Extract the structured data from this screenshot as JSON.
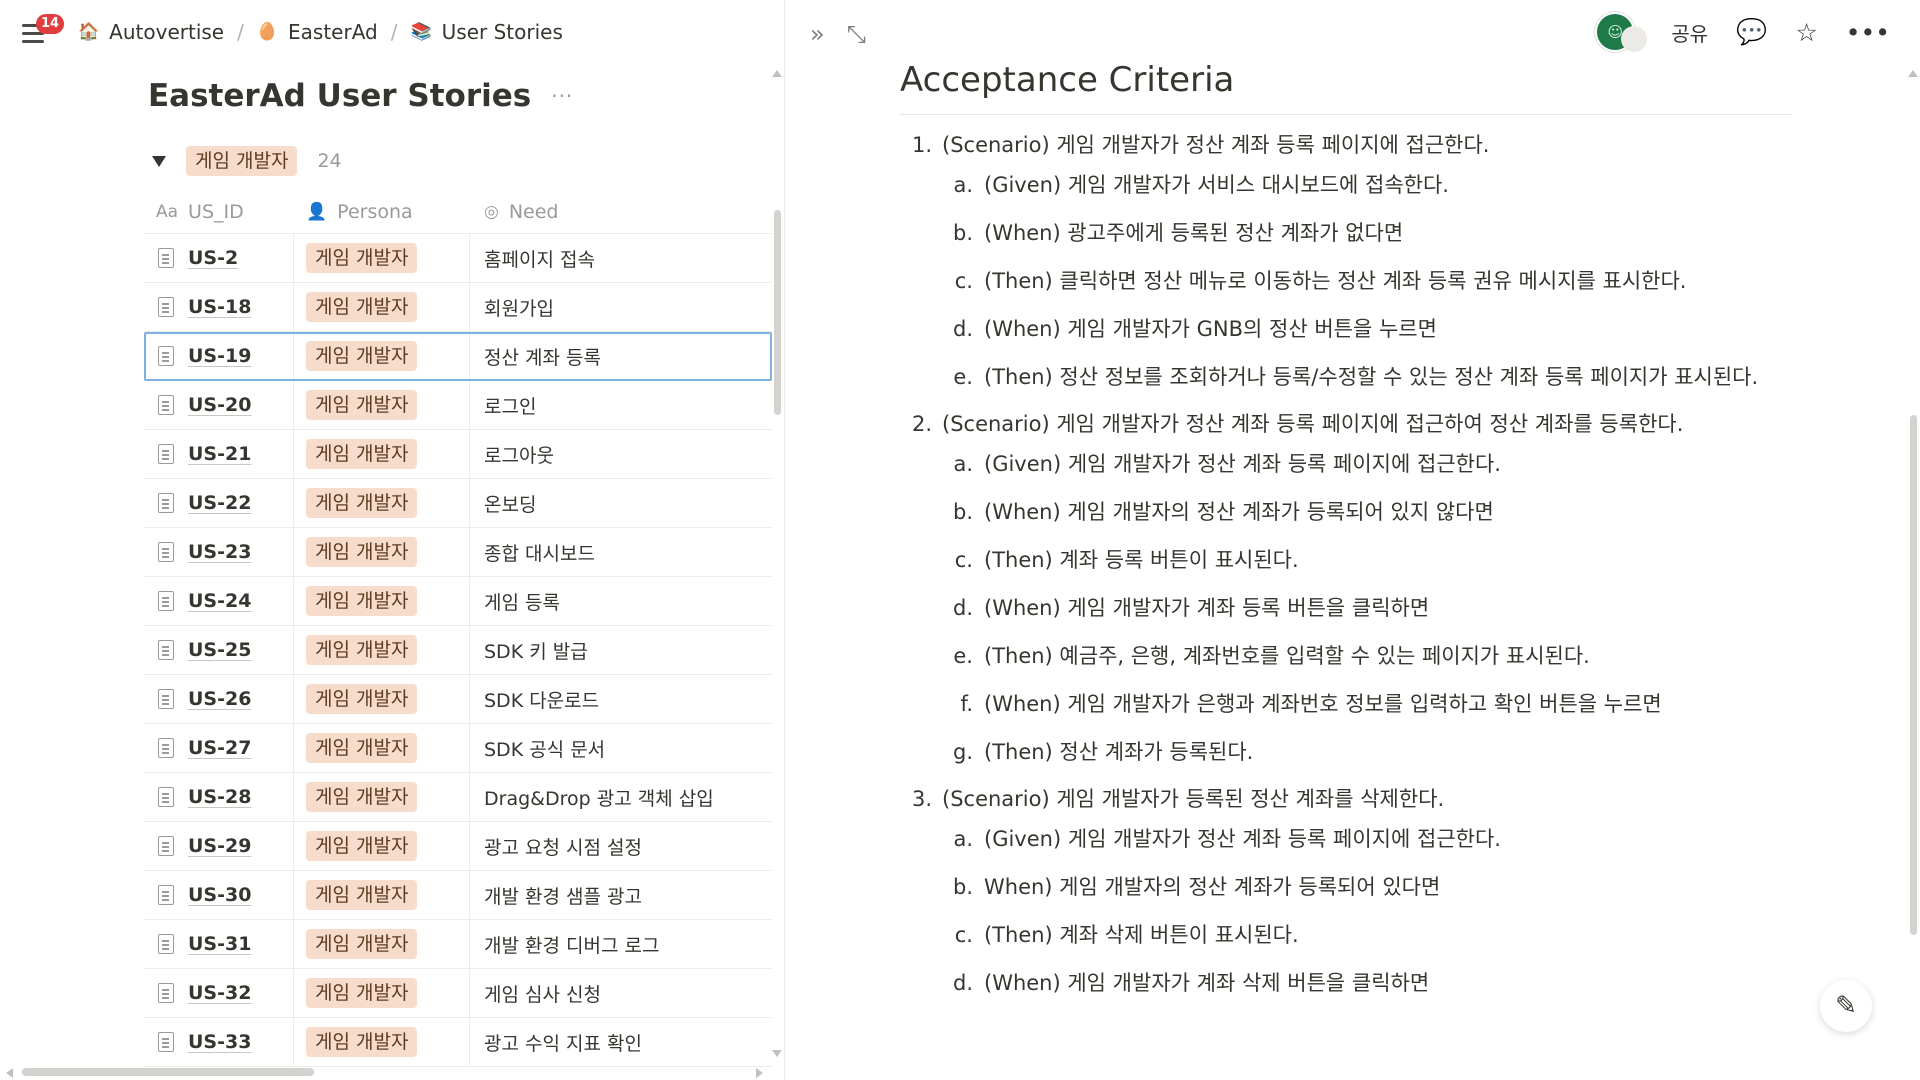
{
  "notification_count": "14",
  "breadcrumb": [
    {
      "icon": "house-icon",
      "label": "Autovertise"
    },
    {
      "icon": "egg-icon",
      "label": "EasterAd"
    },
    {
      "icon": "books-icon",
      "label": "User Stories"
    }
  ],
  "database": {
    "title": "EasterAd User Stories",
    "more_label": "···",
    "group": {
      "label": "게임 개발자",
      "count": "24"
    },
    "columns": {
      "id": "US_ID",
      "id_prefix": "Aa",
      "persona": "Persona",
      "need": "Need"
    },
    "rows": [
      {
        "id": "US-2",
        "persona": "게임 개발자",
        "need": "홈페이지 접속"
      },
      {
        "id": "US-18",
        "persona": "게임 개발자",
        "need": "회원가입"
      },
      {
        "id": "US-19",
        "persona": "게임 개발자",
        "need": "정산 계좌 등록"
      },
      {
        "id": "US-20",
        "persona": "게임 개발자",
        "need": "로그인"
      },
      {
        "id": "US-21",
        "persona": "게임 개발자",
        "need": "로그아웃"
      },
      {
        "id": "US-22",
        "persona": "게임 개발자",
        "need": "온보딩"
      },
      {
        "id": "US-23",
        "persona": "게임 개발자",
        "need": "종합 대시보드"
      },
      {
        "id": "US-24",
        "persona": "게임 개발자",
        "need": "게임 등록"
      },
      {
        "id": "US-25",
        "persona": "게임 개발자",
        "need": "SDK 키 발급"
      },
      {
        "id": "US-26",
        "persona": "게임 개발자",
        "need": "SDK 다운로드"
      },
      {
        "id": "US-27",
        "persona": "게임 개발자",
        "need": "SDK 공식 문서"
      },
      {
        "id": "US-28",
        "persona": "게임 개발자",
        "need": "Drag&Drop 광고 객체 삽입"
      },
      {
        "id": "US-29",
        "persona": "게임 개발자",
        "need": "광고 요청 시점 설정"
      },
      {
        "id": "US-30",
        "persona": "게임 개발자",
        "need": "개발 환경 샘플 광고"
      },
      {
        "id": "US-31",
        "persona": "게임 개발자",
        "need": "개발 환경 디버그 로그"
      },
      {
        "id": "US-32",
        "persona": "게임 개발자",
        "need": "게임 심사 신청"
      },
      {
        "id": "US-33",
        "persona": "게임 개발자",
        "need": "광고 수익 지표 확인"
      }
    ]
  },
  "peek": {
    "share_label": "공유",
    "heading": "Acceptance Criteria",
    "scenarios": [
      {
        "num": "1.",
        "text": "(Scenario) 게임 개발자가 정산 계좌 등록 페이지에 접근한다.",
        "steps": [
          {
            "num": "a.",
            "text": "(Given) 게임 개발자가 서비스 대시보드에 접속한다."
          },
          {
            "num": "b.",
            "text": "(When) 광고주에게 등록된 정산 계좌가 없다면"
          },
          {
            "num": "c.",
            "text": "(Then) 클릭하면 정산 메뉴로 이동하는 정산 계좌 등록 권유 메시지를 표시한다."
          },
          {
            "num": "d.",
            "text": "(When) 게임 개발자가 GNB의 정산 버튼을 누르면"
          },
          {
            "num": "e.",
            "text": "(Then) 정산 정보를 조회하거나 등록/수정할 수 있는 정산 계좌 등록 페이지가 표시된다."
          }
        ]
      },
      {
        "num": "2.",
        "text": "(Scenario) 게임 개발자가 정산 계좌 등록 페이지에 접근하여 정산 계좌를 등록한다.",
        "steps": [
          {
            "num": "a.",
            "text": "(Given) 게임 개발자가 정산 계좌 등록 페이지에 접근한다."
          },
          {
            "num": "b.",
            "text": "(When) 게임 개발자의 정산 계좌가 등록되어 있지 않다면"
          },
          {
            "num": "c.",
            "text": "(Then) 계좌 등록 버튼이 표시된다."
          },
          {
            "num": "d.",
            "text": "(When) 게임 개발자가 계좌 등록 버튼을 클릭하면"
          },
          {
            "num": "e.",
            "text": "(Then) 예금주, 은행, 계좌번호를 입력할 수 있는 페이지가 표시된다."
          },
          {
            "num": "f.",
            "text": "(When) 게임 개발자가 은행과 계좌번호 정보를 입력하고 확인 버튼을 누르면"
          },
          {
            "num": "g.",
            "text": "(Then) 정산 계좌가 등록된다."
          }
        ]
      },
      {
        "num": "3.",
        "text": "(Scenario) 게임 개발자가 등록된 정산 계좌를 삭제한다.",
        "steps": [
          {
            "num": "a.",
            "text": "(Given) 게임 개발자가 정산 계좌 등록 페이지에 접근한다."
          },
          {
            "num": "b.",
            "text": "When) 게임 개발자의 정산 계좌가 등록되어 있다면"
          },
          {
            "num": "c.",
            "text": "(Then) 계좌 삭제 버튼이 표시된다."
          },
          {
            "num": "d.",
            "text": "(When) 게임 개발자가 계좌 삭제 버튼을 클릭하면"
          }
        ]
      }
    ]
  },
  "colors": {
    "tag_bg": "#f8dccb",
    "badge": "#e03e3e",
    "selection": "#7fb1e0"
  }
}
